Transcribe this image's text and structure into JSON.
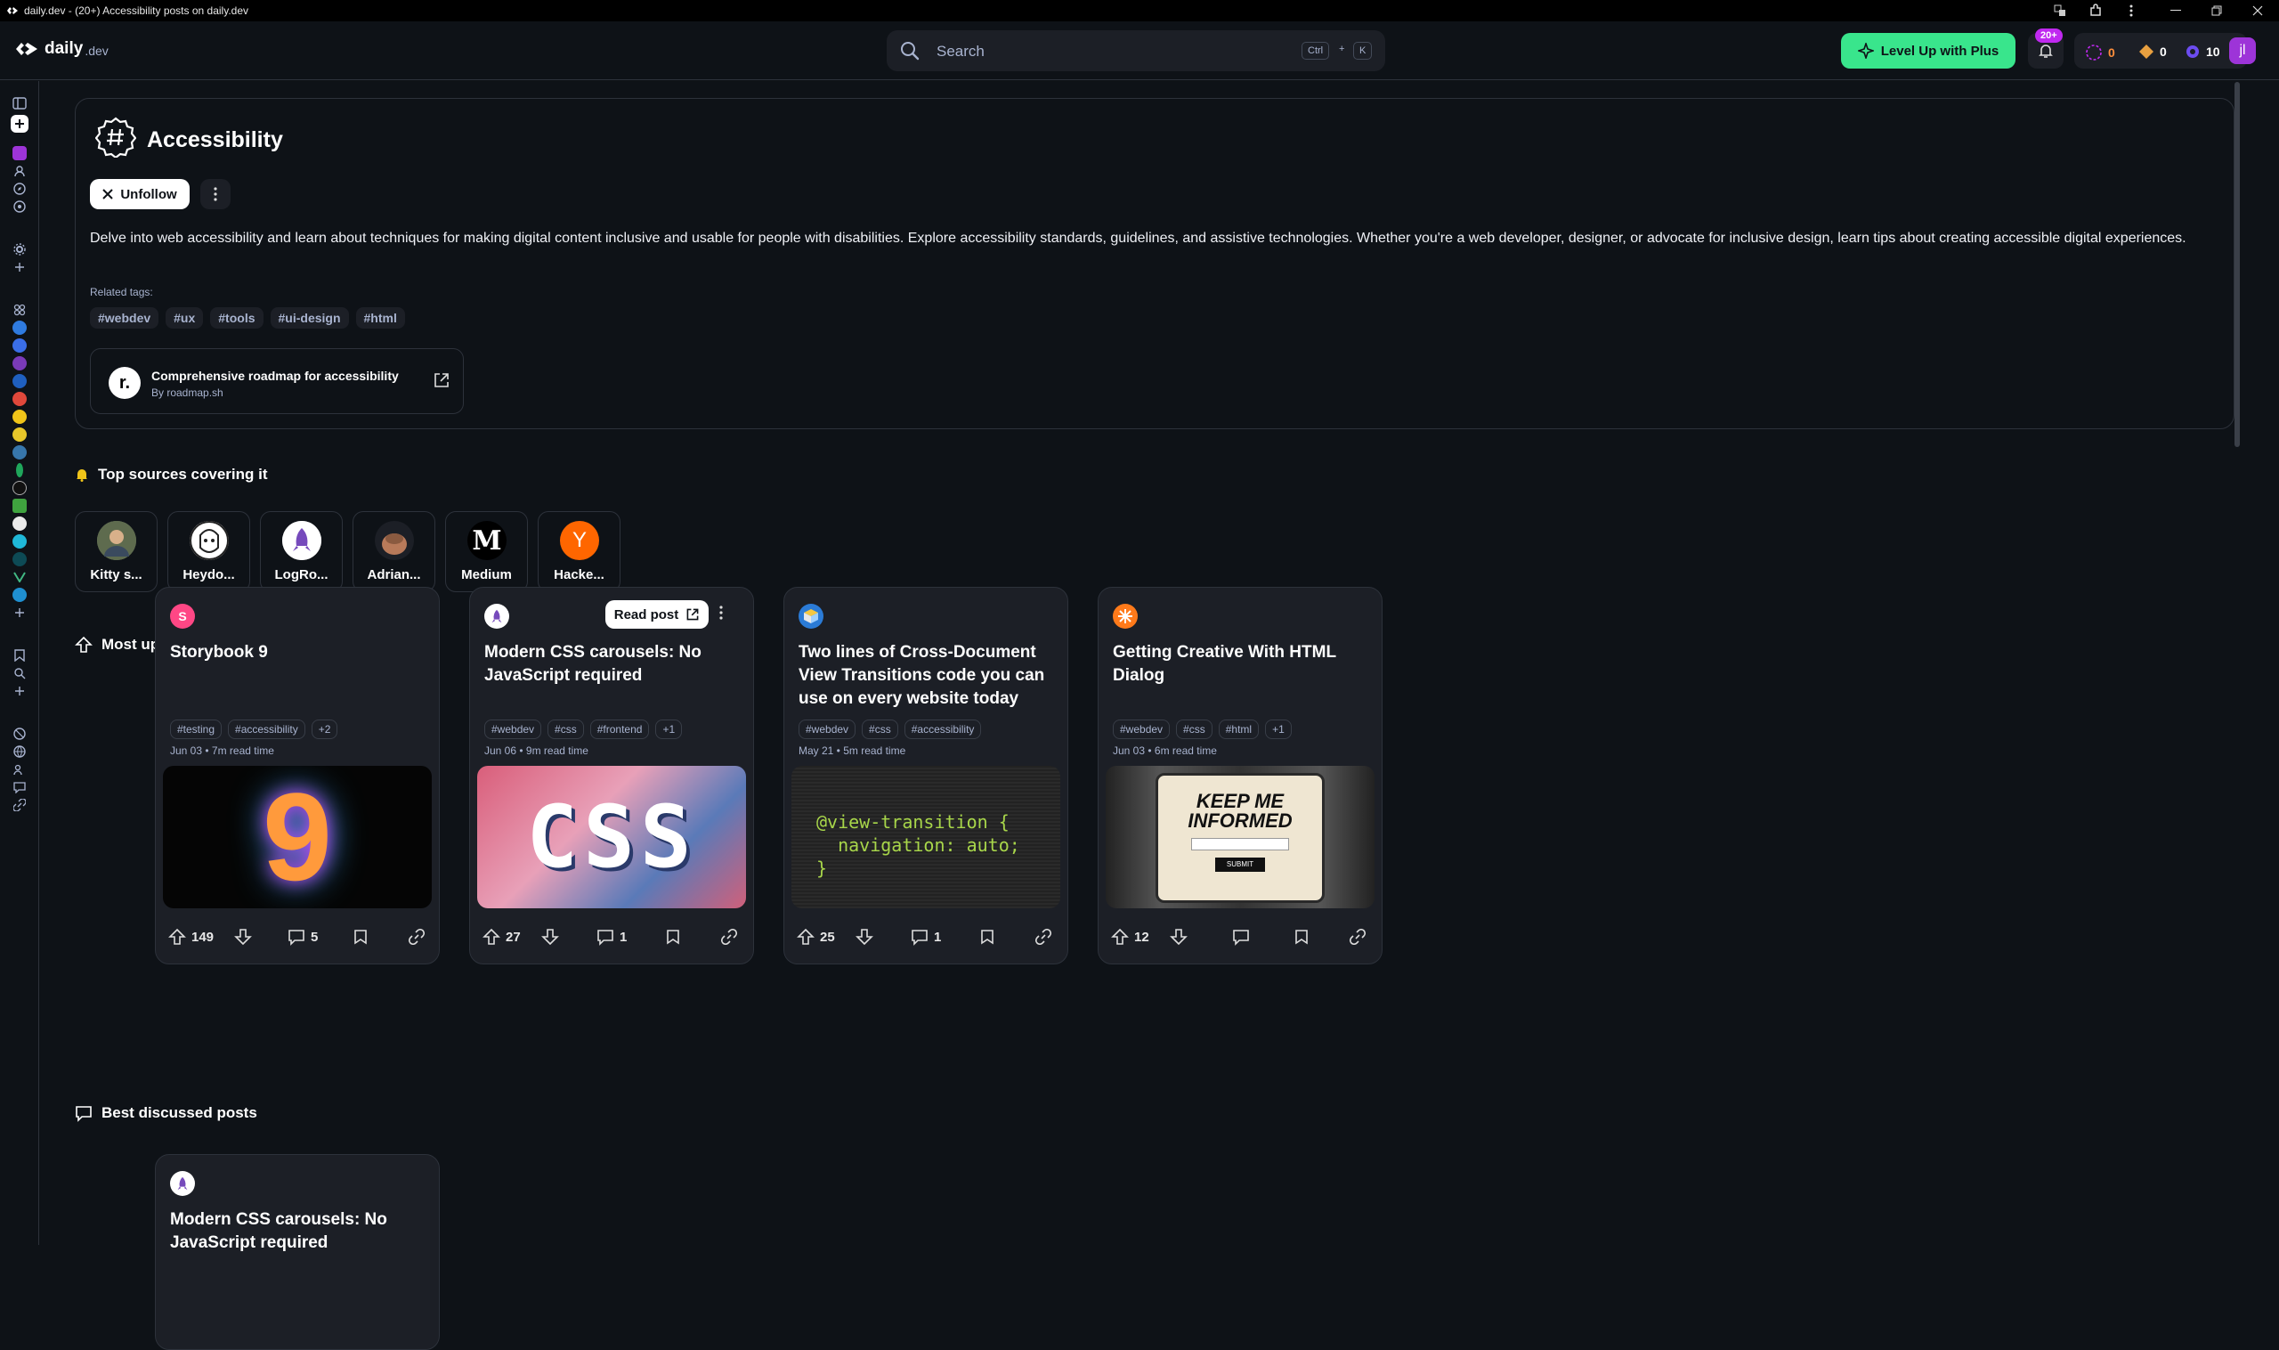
{
  "window": {
    "title": "daily.dev - (20+) Accessibility posts on daily.dev"
  },
  "header": {
    "logo_main": "daily",
    "logo_sub": ".dev",
    "search_placeholder": "Search",
    "shortcut_key1": "Ctrl",
    "shortcut_plus": "+",
    "shortcut_key2": "K",
    "plus_button": "Level Up with Plus",
    "notification_badge": "20+",
    "reputation": "0",
    "cores": "0",
    "streak": "10",
    "avatar_initial": "jl"
  },
  "tag_page": {
    "title": "Accessibility",
    "unfollow_label": "Unfollow",
    "description": "Delve into web accessibility and learn about techniques for making digital content inclusive and usable for people with disabilities. Explore accessibility standards, guidelines, and assistive technologies. Whether you're a web developer, designer, or advocate for inclusive design, learn tips about creating accessible digital experiences.",
    "related_label": "Related tags:",
    "related_tags": [
      "#webdev",
      "#ux",
      "#tools",
      "#ui-design",
      "#html"
    ],
    "roadmap_title": "Comprehensive roadmap for accessibility",
    "roadmap_source": "By roadmap.sh",
    "roadmap_logo": "r."
  },
  "top_sources": {
    "heading": "Top sources covering it",
    "items": [
      {
        "name": "Kitty s...",
        "color": "#7a8a6a",
        "glyph": ""
      },
      {
        "name": "Heydo...",
        "color": "#ffffff",
        "glyph": ""
      },
      {
        "name": "LogRo...",
        "color": "#ffffff",
        "glyph": ""
      },
      {
        "name": "Adrian...",
        "color": "#1c1f26",
        "glyph": ""
      },
      {
        "name": "Medium",
        "color": "#000000",
        "glyph": "M"
      },
      {
        "name": "Hacke...",
        "color": "#ff6600",
        "glyph": "Y"
      }
    ]
  },
  "most_upvoted": {
    "heading": "Most upvoted posts",
    "read_post_label": "Read post",
    "posts": [
      {
        "title": "Storybook 9",
        "tags": [
          "#testing",
          "#accessibility",
          "+2"
        ],
        "meta": "Jun 03 • 7m read time",
        "upvotes": "149",
        "comments": "5",
        "source_color": "#ff4785",
        "source_glyph": "S"
      },
      {
        "title": "Modern CSS carousels: No JavaScript required",
        "tags": [
          "#webdev",
          "#css",
          "#frontend",
          "+1"
        ],
        "meta": "Jun 06 • 9m read time",
        "upvotes": "27",
        "comments": "1",
        "source_color": "#ffffff",
        "source_glyph": ""
      },
      {
        "title": "Two lines of Cross-Document View Transitions code you can use on every website today",
        "tags": [
          "#webdev",
          "#css",
          "#accessibility"
        ],
        "meta": "May 21 • 5m read time",
        "upvotes": "25",
        "comments": "1",
        "source_color": "#2b7bd6",
        "source_glyph": ""
      },
      {
        "title": "Getting Creative With HTML Dialog",
        "tags": [
          "#webdev",
          "#css",
          "#html",
          "+1"
        ],
        "meta": "Jun 03 • 6m read time",
        "upvotes": "12",
        "comments": "",
        "source_color": "#ff7a1a",
        "source_glyph": ""
      }
    ],
    "image_texts": {
      "storybook": "9",
      "css": "CSS",
      "code_line1": "@view-transition {",
      "code_line2": "  navigation: auto;",
      "code_line3": "}",
      "dialog_line1": "KEEP ME",
      "dialog_line2": "INFORMED",
      "dialog_button": "SUBMIT"
    }
  },
  "best_discussed": {
    "heading": "Best discussed posts",
    "first_post_title": "Modern CSS carousels: No JavaScript required"
  }
}
